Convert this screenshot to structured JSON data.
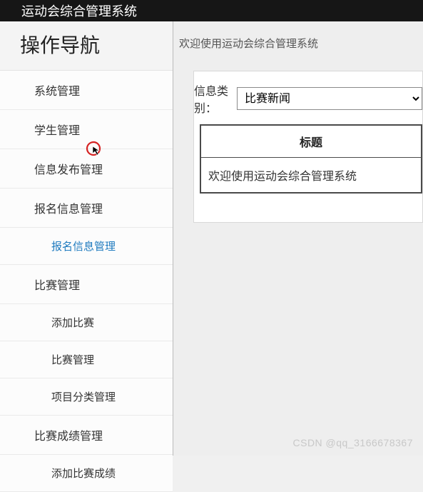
{
  "header": {
    "title": "运动会综合管理系统"
  },
  "sidebar": {
    "title": "操作导航",
    "items": [
      {
        "label": "系统管理",
        "sub": false,
        "active": false
      },
      {
        "label": "学生管理",
        "sub": false,
        "active": false
      },
      {
        "label": "信息发布管理",
        "sub": false,
        "active": false
      },
      {
        "label": "报名信息管理",
        "sub": false,
        "active": false
      },
      {
        "label": "报名信息管理",
        "sub": true,
        "active": true
      },
      {
        "label": "比赛管理",
        "sub": false,
        "active": false
      },
      {
        "label": "添加比赛",
        "sub": true,
        "active": false
      },
      {
        "label": "比赛管理",
        "sub": true,
        "active": false
      },
      {
        "label": "项目分类管理",
        "sub": true,
        "active": false
      },
      {
        "label": "比赛成绩管理",
        "sub": false,
        "active": false
      },
      {
        "label": "添加比赛成绩",
        "sub": true,
        "active": false
      }
    ]
  },
  "content": {
    "breadcrumb": "欢迎使用运动会综合管理系统",
    "filter_label": "信息类别：",
    "filter_value": "比赛新闻",
    "table": {
      "header": "标题",
      "rows": [
        {
          "title": "欢迎使用运动会综合管理系统"
        }
      ]
    }
  },
  "watermark": "CSDN @qq_3166678367"
}
